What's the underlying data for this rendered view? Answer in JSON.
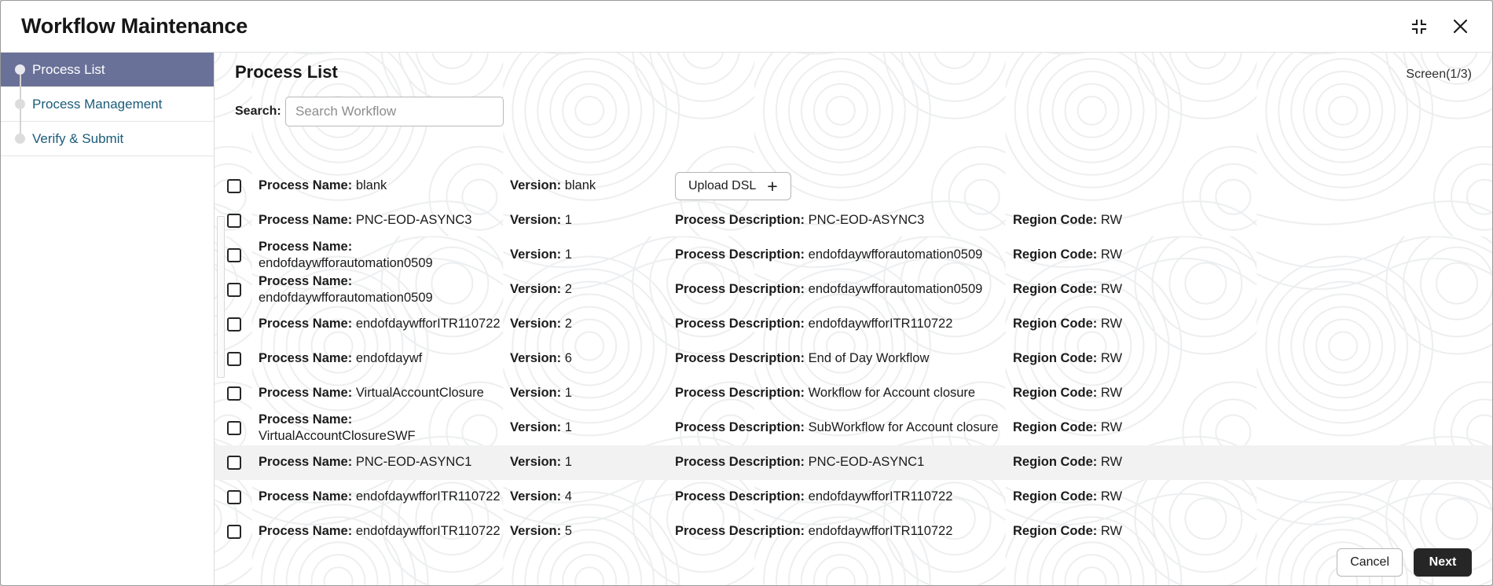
{
  "window": {
    "title": "Workflow Maintenance",
    "minimize_icon": "collapse-icon",
    "close_icon": "close-icon"
  },
  "sidebar": {
    "items": [
      {
        "label": "Process List",
        "active": true
      },
      {
        "label": "Process Management",
        "active": false
      },
      {
        "label": "Verify & Submit",
        "active": false
      }
    ]
  },
  "main": {
    "page_title": "Process List",
    "screen_counter": "Screen(1/3)",
    "search": {
      "label": "Search:",
      "placeholder": "Search Workflow",
      "value": ""
    },
    "upload_button": {
      "label": "Upload DSL",
      "icon": "plus-icon"
    },
    "labels": {
      "process_name": "Process Name:",
      "version": "Version:",
      "process_description": "Process Description:",
      "region_code": "Region Code:"
    },
    "rows": [
      {
        "name": "blank",
        "version": "blank",
        "description": "",
        "region": "",
        "has_upload": true,
        "highlight": false
      },
      {
        "name": "PNC-EOD-ASYNC3",
        "version": "1",
        "description": "PNC-EOD-ASYNC3",
        "region": "RW",
        "has_upload": false,
        "highlight": false
      },
      {
        "name": "endofdaywfforautomation0509",
        "version": "1",
        "description": "endofdaywfforautomation0509",
        "region": "RW",
        "has_upload": false,
        "highlight": false
      },
      {
        "name": "endofdaywfforautomation0509",
        "version": "2",
        "description": "endofdaywfforautomation0509",
        "region": "RW",
        "has_upload": false,
        "highlight": false
      },
      {
        "name": "endofdaywfforITR110722",
        "version": "2",
        "description": "endofdaywfforITR110722",
        "region": "RW",
        "has_upload": false,
        "highlight": false
      },
      {
        "name": "endofdaywf",
        "version": "6",
        "description": "End of Day Workflow",
        "region": "RW",
        "has_upload": false,
        "highlight": false
      },
      {
        "name": "VirtualAccountClosure",
        "version": "1",
        "description": "Workflow for Account closure",
        "region": "RW",
        "has_upload": false,
        "highlight": false
      },
      {
        "name": "VirtualAccountClosureSWF",
        "version": "1",
        "description": "SubWorkflow for Account closure",
        "region": "RW",
        "has_upload": false,
        "highlight": false
      },
      {
        "name": "PNC-EOD-ASYNC1",
        "version": "1",
        "description": "PNC-EOD-ASYNC1",
        "region": "RW",
        "has_upload": false,
        "highlight": true
      },
      {
        "name": "endofdaywfforITR110722",
        "version": "4",
        "description": "endofdaywfforITR110722",
        "region": "RW",
        "has_upload": false,
        "highlight": false
      },
      {
        "name": "endofdaywfforITR110722",
        "version": "5",
        "description": "endofdaywfforITR110722",
        "region": "RW",
        "has_upload": false,
        "highlight": false
      }
    ]
  },
  "footer": {
    "cancel_label": "Cancel",
    "next_label": "Next"
  },
  "colors": {
    "sidebar_active": "#6a7198",
    "link": "#1a5b78",
    "primary_button": "#262626",
    "row_highlight": "#f2f2f2"
  }
}
